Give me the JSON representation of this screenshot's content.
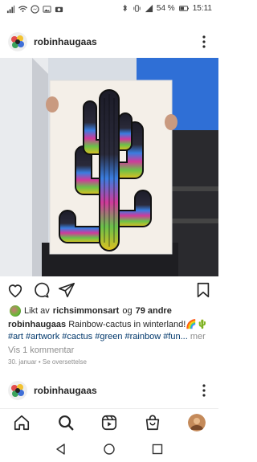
{
  "status": {
    "left_icons": [
      "signal-icon",
      "wifi-icon",
      "messenger-icon",
      "gallery-icon",
      "camera-icon"
    ],
    "battery": "54 %",
    "time": "15:11"
  },
  "post": {
    "username": "robinhaugaas",
    "likes": {
      "prefix": "Likt av",
      "user": "richsimmonsart",
      "joiner": "og",
      "others": "79 andre"
    },
    "caption": {
      "username": "robinhaugaas",
      "text": "Rainbow-cactus in winterland!🌈🌵",
      "hashtags": "#art #artwork #cactus #green #rainbow #fun...",
      "more": "mer"
    },
    "view_comments": "Vis 1 kommentar",
    "date": "30. januar",
    "translate": "Se oversettelse"
  },
  "next_post": {
    "username": "robinhaugaas"
  },
  "colors": {
    "link": "#00376b",
    "muted": "#8e8e8e",
    "text": "#262626"
  }
}
